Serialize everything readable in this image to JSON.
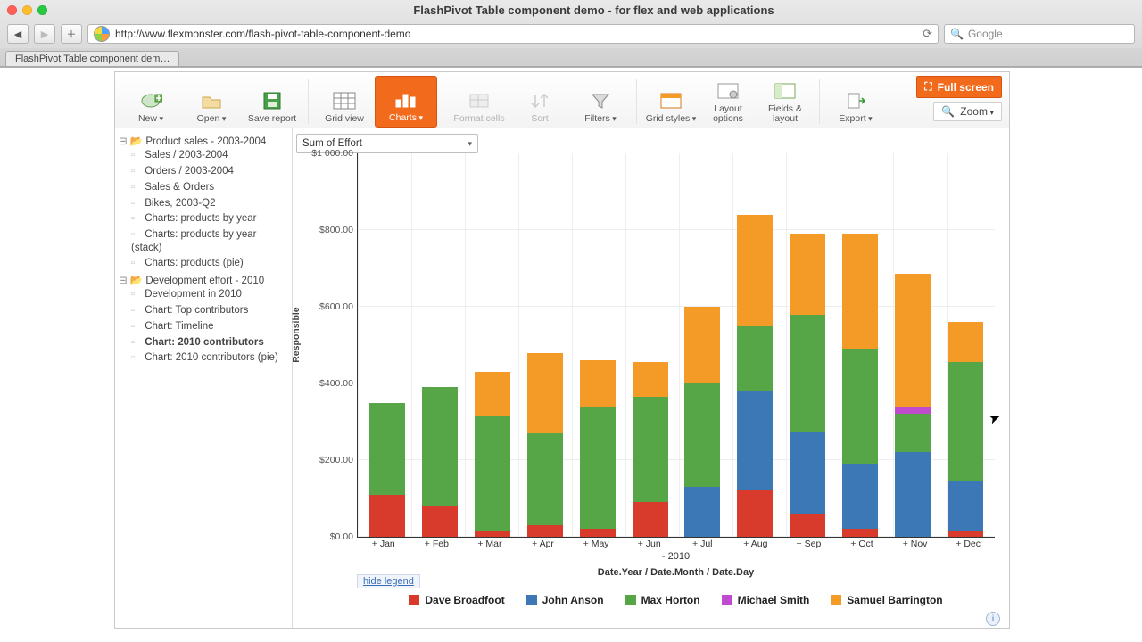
{
  "window_title": "FlashPivot Table component demo - for flex and web applications",
  "url": "http://www.flexmonster.com/flash-pivot-table-component-demo",
  "search_placeholder": "Google",
  "tab_title": "FlashPivot Table component dem…",
  "toolbar": {
    "new": "New",
    "open": "Open",
    "save": "Save report",
    "grid": "Grid view",
    "charts": "Charts",
    "format": "Format cells",
    "sort": "Sort",
    "filters": "Filters",
    "gridstyles": "Grid styles",
    "layoutopts": "Layout options",
    "fields": "Fields & layout",
    "export": "Export",
    "fullscreen": "Full screen",
    "zoom": "Zoom"
  },
  "tree": {
    "group1": "Product sales - 2003-2004",
    "g1": [
      "Sales / 2003-2004",
      "Orders / 2003-2004",
      "Sales & Orders",
      "Bikes, 2003-Q2",
      "Charts: products by year",
      "Charts: products by year (stack)",
      "Charts: products (pie)"
    ],
    "group2": "Development effort - 2010",
    "g2": [
      "Development in 2010",
      "Chart: Top contributors",
      "Chart: Timeline",
      "Chart: 2010 contributors",
      "Chart: 2010 contributors (pie)"
    ],
    "selected": "Chart: 2010 contributors"
  },
  "measure": "Sum of Effort",
  "hide_legend": "hide legend",
  "ylabel": "Responsible",
  "chart_data": {
    "type": "bar",
    "stacked": true,
    "categories": [
      "+ Jan",
      "+ Feb",
      "+ Mar",
      "+ Apr",
      "+ May",
      "+ Jun",
      "+ Jul",
      "+ Aug",
      "+ Sep",
      "+ Oct",
      "+ Nov",
      "+ Dec"
    ],
    "xgroup": "- 2010",
    "xlabel": "Date.Year / Date.Month / Date.Day",
    "ylabel": "Responsible",
    "yticks": [
      "$0.00",
      "$200.00",
      "$400.00",
      "$600.00",
      "$800.00",
      "$1 000.00"
    ],
    "ylim": [
      0,
      1000
    ],
    "legend_position": "bottom",
    "series": [
      {
        "name": "Dave Broadfoot",
        "color": "#d83a2b",
        "values": [
          110,
          80,
          15,
          30,
          20,
          90,
          0,
          120,
          60,
          20,
          0,
          15
        ]
      },
      {
        "name": "John Anson",
        "color": "#3c78b5",
        "values": [
          0,
          0,
          0,
          0,
          0,
          0,
          130,
          260,
          215,
          170,
          220,
          130
        ]
      },
      {
        "name": "Max Horton",
        "color": "#56a546",
        "values": [
          240,
          310,
          300,
          240,
          320,
          275,
          270,
          170,
          305,
          300,
          100,
          310
        ]
      },
      {
        "name": "Michael Smith",
        "color": "#c04bce",
        "values": [
          0,
          0,
          0,
          0,
          0,
          0,
          0,
          0,
          0,
          0,
          20,
          0
        ]
      },
      {
        "name": "Samuel Barrington",
        "color": "#f49a27",
        "values": [
          0,
          0,
          115,
          210,
          120,
          90,
          200,
          290,
          210,
          300,
          345,
          105
        ]
      }
    ]
  }
}
